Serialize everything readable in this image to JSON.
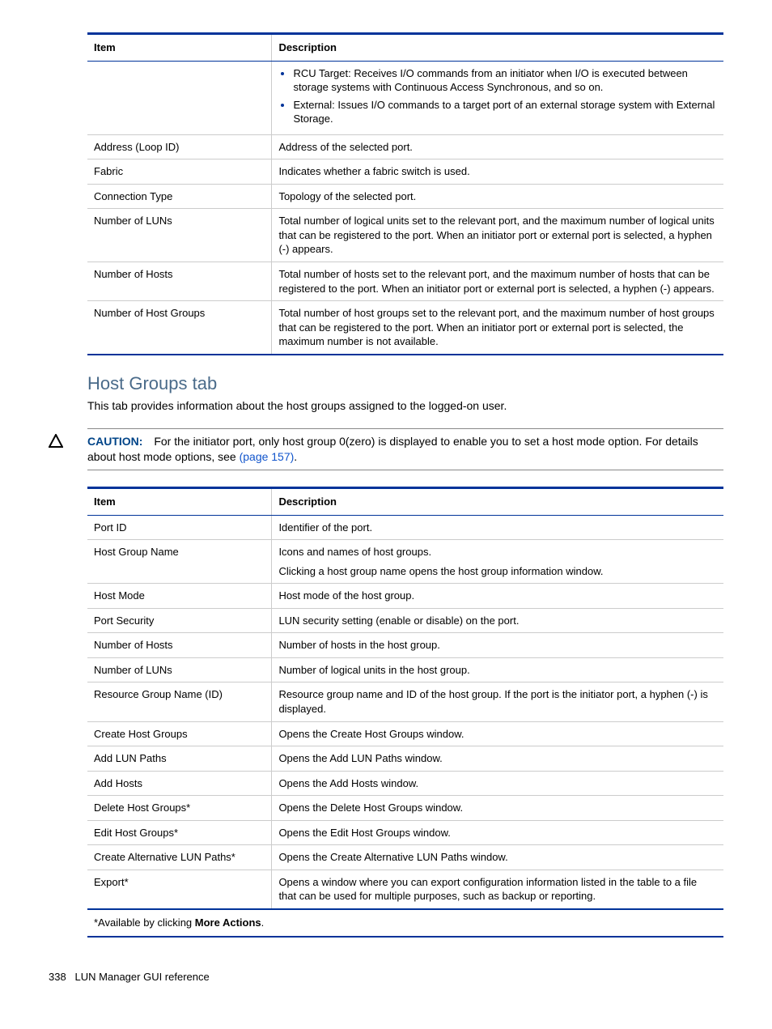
{
  "table1": {
    "headers": {
      "item": "Item",
      "desc": "Description"
    },
    "rows": [
      {
        "item": "",
        "desc_list": [
          "RCU Target: Receives I/O commands from an initiator when I/O is executed between storage systems with Continuous Access Synchronous, and so on.",
          "External: Issues I/O commands to a target port of an external storage system with External Storage."
        ]
      },
      {
        "item": "Address (Loop ID)",
        "desc": "Address of the selected port."
      },
      {
        "item": "Fabric",
        "desc": "Indicates whether a fabric switch is used."
      },
      {
        "item": "Connection Type",
        "desc": "Topology of the selected port."
      },
      {
        "item": "Number of LUNs",
        "desc": "Total number of logical units set to the relevant port, and the maximum number of logical units that can be registered to the port. When an initiator port or external port is selected, a hyphen (-) appears."
      },
      {
        "item": "Number of Hosts",
        "desc": "Total number of hosts set to the relevant port, and the maximum number of hosts that can be registered to the port. When an initiator port or external port is selected, a hyphen (-) appears."
      },
      {
        "item": "Number of Host Groups",
        "desc": "Total number of host groups set to the relevant port, and the maximum number of host groups that can be registered to the port. When an initiator port or external port is selected, the maximum number is not available."
      }
    ]
  },
  "section_title": "Host Groups tab",
  "section_body": "This tab provides information about the host groups assigned to the logged-on user.",
  "caution": {
    "label": "CAUTION:",
    "text_pre": "For the initiator port, only host group 0(zero) is displayed to enable you to set a host mode option. For details about host mode options, see ",
    "link": "(page 157)",
    "text_post": "."
  },
  "table2": {
    "headers": {
      "item": "Item",
      "desc": "Description"
    },
    "rows": [
      {
        "item": "Port ID",
        "desc": "Identifier of the port."
      },
      {
        "item": "Host Group Name",
        "desc": "Icons and names of host groups.",
        "desc2": "Clicking a host group name opens the host group information window."
      },
      {
        "item": "Host Mode",
        "desc": "Host mode of the host group."
      },
      {
        "item": "Port Security",
        "desc": "LUN security setting (enable or disable) on the port."
      },
      {
        "item": "Number of Hosts",
        "desc": "Number of hosts in the host group."
      },
      {
        "item": "Number of LUNs",
        "desc": "Number of logical units in the host group."
      },
      {
        "item": "Resource Group Name (ID)",
        "desc": "Resource group name and ID of the host group. If the port is the initiator port, a hyphen (-) is displayed."
      },
      {
        "item": "Create Host Groups",
        "desc": "Opens the Create Host Groups window."
      },
      {
        "item": "Add LUN Paths",
        "desc": "Opens the Add LUN Paths window."
      },
      {
        "item": "Add Hosts",
        "desc": "Opens the Add Hosts window."
      },
      {
        "item": "Delete Host Groups*",
        "desc": "Opens the Delete Host Groups window."
      },
      {
        "item": "Edit Host Groups*",
        "desc": "Opens the Edit Host Groups window."
      },
      {
        "item": "Create Alternative LUN Paths*",
        "desc": "Opens the Create Alternative LUN Paths window."
      },
      {
        "item": "Export*",
        "desc": "Opens a window where you can export configuration information listed in the table to a file that can be used for multiple purposes, such as backup or reporting."
      }
    ],
    "footnote_pre": "*Available by clicking ",
    "footnote_bold": "More Actions",
    "footnote_post": "."
  },
  "page_footer": {
    "num": "338",
    "title": "LUN Manager GUI reference"
  }
}
